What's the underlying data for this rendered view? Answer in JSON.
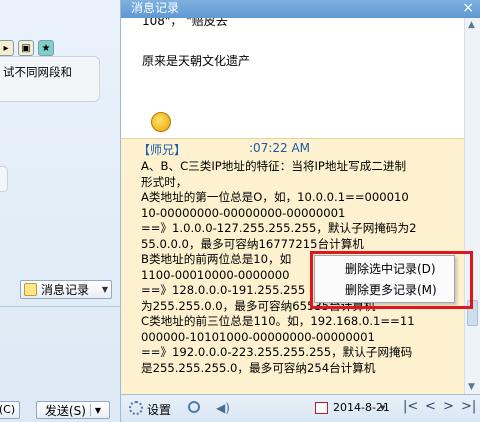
{
  "left": {
    "bubble_text": "试不同网段和",
    "msg_record_label": "消息记录",
    "close_shortcut_label": "(C)",
    "send_label": "发送(S)",
    "icons": [
      "folder-icon",
      "image-icon",
      "star-icon"
    ]
  },
  "history": {
    "title": "消息记录",
    "close_label": "×",
    "partial_top_line": "108\"，  \"赔皮去",
    "line_origin": "原来是天朝文化遗产",
    "quote": {
      "author": "【师兄】",
      "time": ":07:22 AM",
      "lines": [
        "A、B、C三类IP地址的特征：当将IP地址写成二进制",
        "形式时，",
        "A类地址的第一位总是O，如，10.0.0.1==000010",
        "10-00000000-00000000-00000001",
        "==》1.0.0.0-127.255.255.255，默认子网掩码为2",
        "55.0.0.0，最多可容纳16777215台计算机",
        "B类地址的前两位总是10，如",
        "1100-00010000-0000000",
        "==》128.0.0.0-191.255.255",
        "为255.255.0.0，最多可容纳65535台计算机",
        "C类地址的前三位总是110。如，192.168.0.1==11",
        "000000-10101000-00000000-00000001",
        "==》192.0.0.0-223.255.255.255，默认子网掩码",
        "是255.255.255.0，最多可容纳254台计算机"
      ]
    },
    "context_menu": {
      "item1": "删除选中记录(D)",
      "item2": "删除更多记录(M)"
    },
    "toolbar": {
      "settings_label": "设置",
      "date": "2014-8-21",
      "nav_first": "|<",
      "nav_prev": "<",
      "nav_next": ">",
      "nav_last": ">|"
    }
  },
  "colors": {
    "quote_bg": "#fdf1cf",
    "highlight_border": "#e0151d",
    "header_bg": "#6aa2d8"
  }
}
